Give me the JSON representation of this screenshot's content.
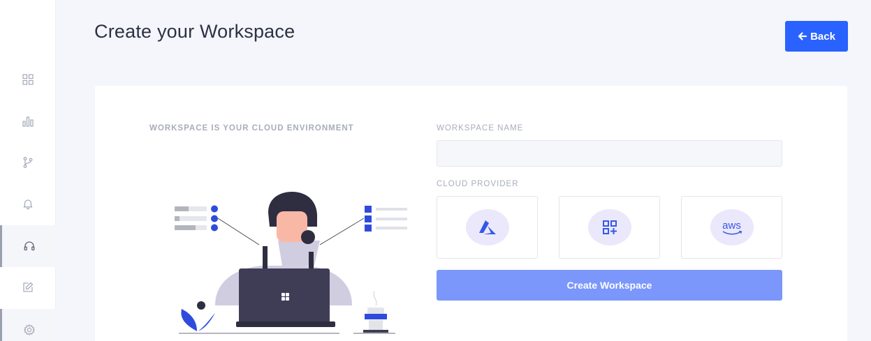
{
  "page": {
    "title": "Create your Workspace"
  },
  "header": {
    "back_label": "Back"
  },
  "sidebar": {
    "items": [
      {
        "icon": "grid-icon"
      },
      {
        "icon": "bar-chart-icon"
      },
      {
        "icon": "git-branch-icon"
      },
      {
        "icon": "bell-icon"
      },
      {
        "icon": "headset-icon",
        "active": true
      },
      {
        "icon": "edit-icon"
      },
      {
        "icon": "gear-icon"
      }
    ]
  },
  "card": {
    "caption": "WORKSPACE IS YOUR CLOUD ENVIRONMENT",
    "workspace_name_label": "WORKSPACE NAME",
    "workspace_name_value": "",
    "cloud_provider_label": "CLOUD PROVIDER",
    "providers": [
      {
        "icon": "azure-icon"
      },
      {
        "icon": "gcp-icon"
      },
      {
        "icon": "aws-icon",
        "text": "aws"
      }
    ],
    "create_label": "Create Workspace"
  },
  "colors": {
    "primary": "#2962ff",
    "create_button": "#7b97fb",
    "provider_circle": "#ebe8fc",
    "background": "#f5f6fb"
  }
}
